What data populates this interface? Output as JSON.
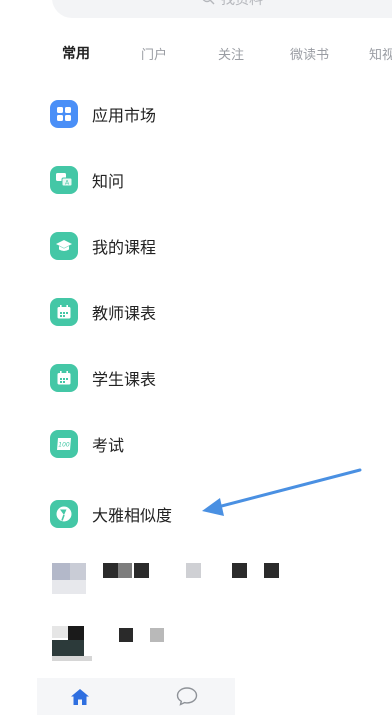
{
  "search": {
    "placeholder": "找资料"
  },
  "tabs": [
    {
      "label": "常用"
    },
    {
      "label": "门户"
    },
    {
      "label": "关注"
    },
    {
      "label": "微读书"
    },
    {
      "label": "知视"
    }
  ],
  "list": [
    {
      "label": "应用市场",
      "icon": "grid-icon",
      "color": "#4a8ff7"
    },
    {
      "label": "知问",
      "icon": "qa-icon",
      "color": "#44c7a6"
    },
    {
      "label": "我的课程",
      "icon": "graduation-cap-icon",
      "color": "#44c7a6"
    },
    {
      "label": "教师课表",
      "icon": "calendar-icon",
      "color": "#44c7a6"
    },
    {
      "label": "学生课表",
      "icon": "calendar-icon",
      "color": "#44c7a6"
    },
    {
      "label": "考试",
      "icon": "exam-paper-icon",
      "color": "#44c7a6"
    },
    {
      "label": "大雅相似度",
      "icon": "daya-logo-icon",
      "color": "#44c7a6"
    }
  ],
  "colors": {
    "accent_blue": "#4a8ff7",
    "app_green": "#44c7a6",
    "arrow_blue": "#4a90e2"
  },
  "bottom_nav": [
    {
      "icon": "home-icon"
    },
    {
      "icon": "chat-bubble-icon"
    }
  ]
}
